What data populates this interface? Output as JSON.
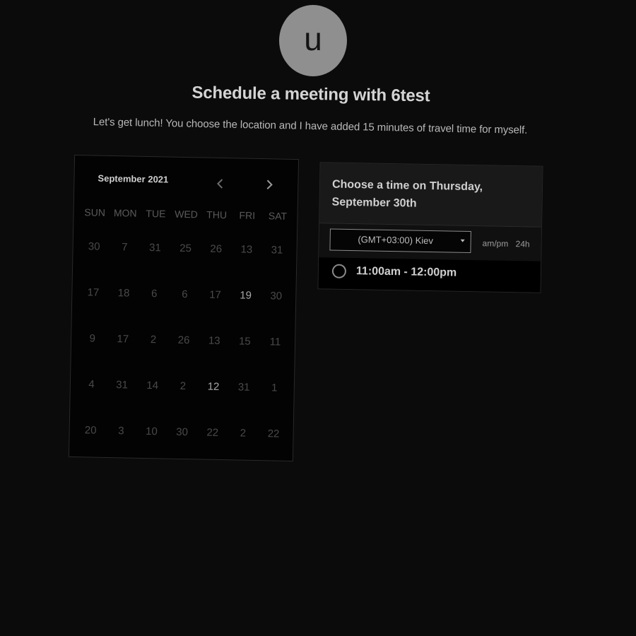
{
  "host": {
    "avatar_initial": "u",
    "title": "Schedule a meeting with 6test",
    "description": "Let's get lunch! You choose the location and I have added 15 minutes of travel time for myself."
  },
  "calendar": {
    "month_label": "September 2021",
    "prev_icon": "chevron-left-icon",
    "next_icon": "chevron-right-icon",
    "weekdays": [
      "SUN",
      "MON",
      "TUE",
      "WED",
      "THU",
      "FRI",
      "SAT"
    ],
    "weeks": [
      [
        {
          "d": "30",
          "a": false
        },
        {
          "d": "7",
          "a": false
        },
        {
          "d": "31",
          "a": false
        },
        {
          "d": "25",
          "a": false
        },
        {
          "d": "26",
          "a": false
        },
        {
          "d": "13",
          "a": false
        },
        {
          "d": "31",
          "a": false
        }
      ],
      [
        {
          "d": "17",
          "a": false
        },
        {
          "d": "18",
          "a": false
        },
        {
          "d": "6",
          "a": false
        },
        {
          "d": "6",
          "a": false
        },
        {
          "d": "17",
          "a": false
        },
        {
          "d": "19",
          "a": true
        },
        {
          "d": "30",
          "a": false
        }
      ],
      [
        {
          "d": "9",
          "a": false
        },
        {
          "d": "17",
          "a": false
        },
        {
          "d": "2",
          "a": false
        },
        {
          "d": "26",
          "a": false
        },
        {
          "d": "13",
          "a": false
        },
        {
          "d": "15",
          "a": false
        },
        {
          "d": "11",
          "a": false
        }
      ],
      [
        {
          "d": "4",
          "a": false
        },
        {
          "d": "31",
          "a": false
        },
        {
          "d": "14",
          "a": false
        },
        {
          "d": "2",
          "a": false
        },
        {
          "d": "12",
          "a": true
        },
        {
          "d": "31",
          "a": false
        },
        {
          "d": "1",
          "a": false
        }
      ],
      [
        {
          "d": "20",
          "a": false
        },
        {
          "d": "3",
          "a": false
        },
        {
          "d": "10",
          "a": false
        },
        {
          "d": "30",
          "a": false
        },
        {
          "d": "22",
          "a": false
        },
        {
          "d": "2",
          "a": false
        },
        {
          "d": "22",
          "a": false
        }
      ]
    ]
  },
  "times": {
    "heading": "Choose a time on Thursday, September 30th",
    "timezone": "(GMT+03:00) Kiev",
    "format_ampm": "am/pm",
    "format_24h": "24h",
    "slots": [
      "11:00am - 12:00pm"
    ]
  },
  "colors": {
    "background": "#0b0b0b",
    "avatar": "#8f8f8f",
    "calendar_bg": "#030303",
    "panel_header": "#191919"
  }
}
